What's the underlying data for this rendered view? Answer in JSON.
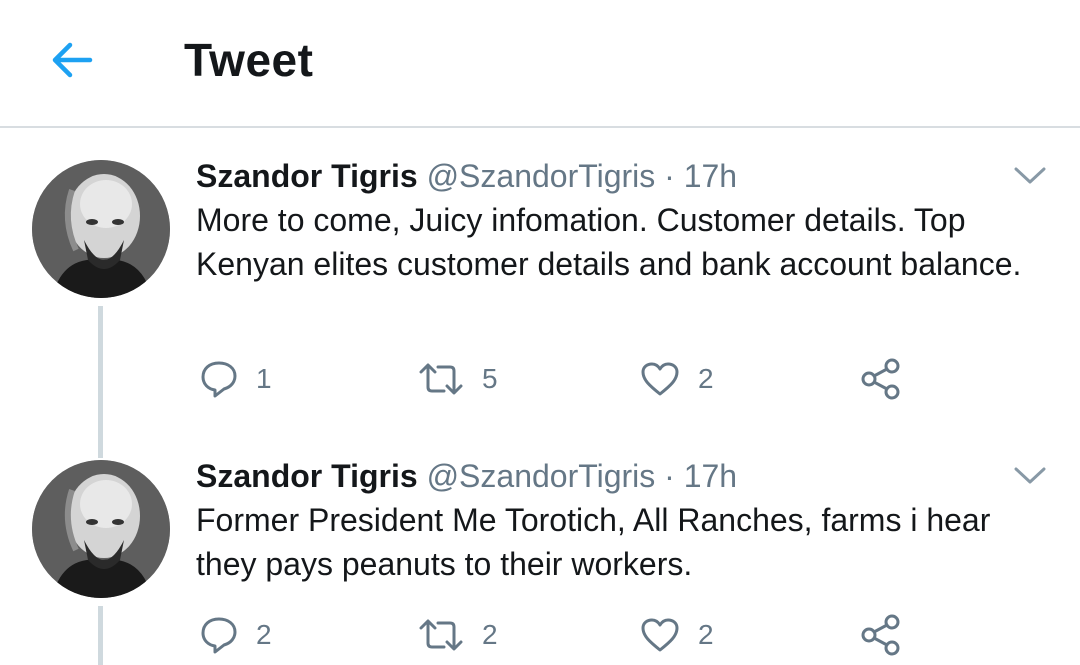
{
  "header": {
    "title": "Tweet",
    "back_icon": "arrow-left-icon",
    "accent": "#1da1f2"
  },
  "tweets": [
    {
      "name": "Szandor Tigris",
      "handle": "@SzandorTigris",
      "separator": "·",
      "time": "17h",
      "text": "More to come, Juicy infomation. Customer details. Top Kenyan elites customer details and bank account balance.",
      "replies": "1",
      "retweets": "5",
      "likes": "2"
    },
    {
      "name": "Szandor Tigris",
      "handle": "@SzandorTigris",
      "separator": "·",
      "time": "17h",
      "text": "Former President Me Torotich, All Ranches, farms i hear they pays peanuts to their workers.",
      "replies": "2",
      "retweets": "2",
      "likes": "2"
    }
  ],
  "icons": {
    "reply": "reply-icon",
    "retweet": "retweet-icon",
    "like": "heart-icon",
    "share": "share-icon",
    "caret": "chevron-down-icon"
  },
  "colors": {
    "text": "#14171a",
    "secondary": "#657786",
    "thread_line": "#cfd9de",
    "border": "#d8dde1"
  }
}
